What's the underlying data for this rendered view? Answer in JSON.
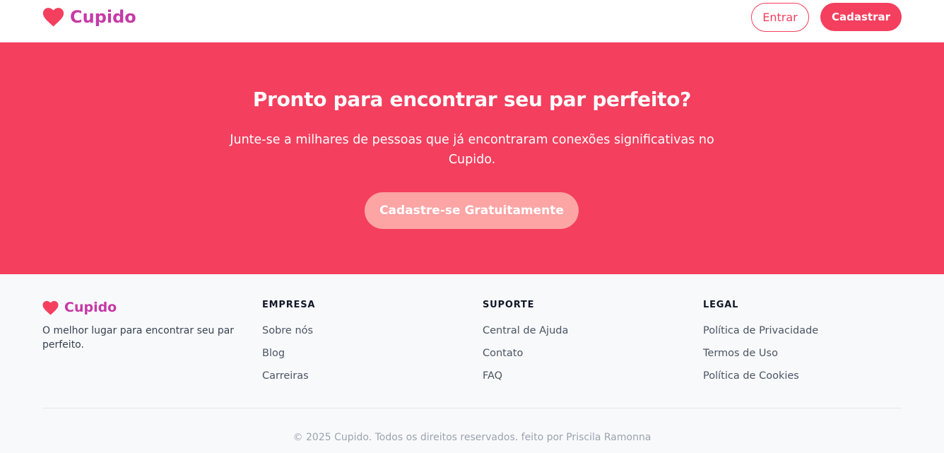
{
  "colors": {
    "primary": "#f43f5e",
    "brand_text": "#c53aa6",
    "cta_light": "#fda4a4",
    "footer_bg": "#f8f9fb"
  },
  "header": {
    "logo": {
      "icon": "heart-icon",
      "text": "Cupido"
    },
    "login_label": "Entrar",
    "signup_label": "Cadastrar"
  },
  "hero": {
    "title": "Pronto para encontrar seu par perfeito?",
    "subtitle": "Junte-se a milhares de pessoas que já encontraram conexões significativas no Cupido.",
    "cta_label": "Cadastre-se Gratuitamente"
  },
  "footer": {
    "logo": {
      "icon": "heart-icon",
      "text": "Cupido"
    },
    "tagline": "O melhor lugar para encontrar seu par perfeito.",
    "columns": [
      {
        "title": "EMPRESA",
        "links": [
          "Sobre nós",
          "Blog",
          "Carreiras"
        ]
      },
      {
        "title": "SUPORTE",
        "links": [
          "Central de Ajuda",
          "Contato",
          "FAQ"
        ]
      },
      {
        "title": "LEGAL",
        "links": [
          "Política de Privacidade",
          "Termos de Uso",
          "Política de Cookies"
        ]
      }
    ],
    "copyright": "© 2025 Cupido. Todos os direitos reservados. feito por Priscila Ramonna"
  }
}
